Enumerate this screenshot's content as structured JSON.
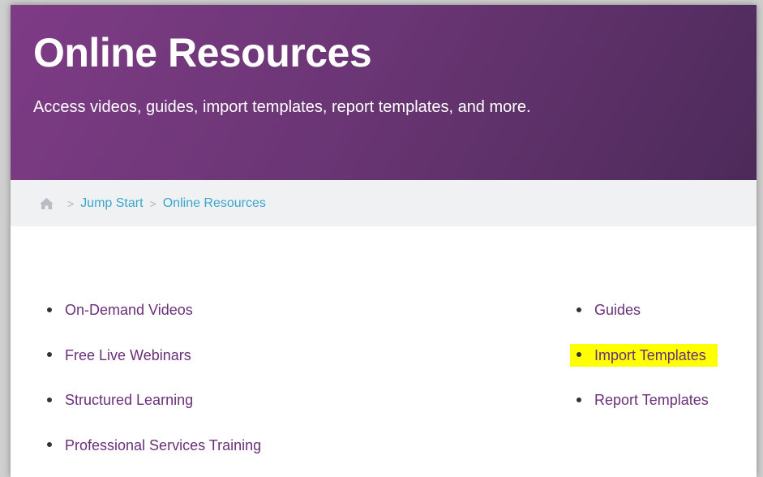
{
  "hero": {
    "title": "Online Resources",
    "subtitle": "Access videos, guides, import templates, report templates, and more."
  },
  "breadcrumb": {
    "home_icon": "home-icon",
    "separator": ">",
    "items": [
      "Jump Start",
      "Online Resources"
    ]
  },
  "resources": {
    "left": [
      "On-Demand Videos",
      "Free Live Webinars",
      "Structured Learning",
      "Professional Services Training"
    ],
    "right": [
      "Guides",
      "Import Templates",
      "Report Templates"
    ],
    "highlighted": "Import Templates",
    "highlight_color": "#ffff00"
  },
  "colors": {
    "hero_start": "#7e3b86",
    "hero_end": "#4d2a5a",
    "breadcrumb_link": "#3aa6cd",
    "resource_link": "#6a2f7a"
  }
}
